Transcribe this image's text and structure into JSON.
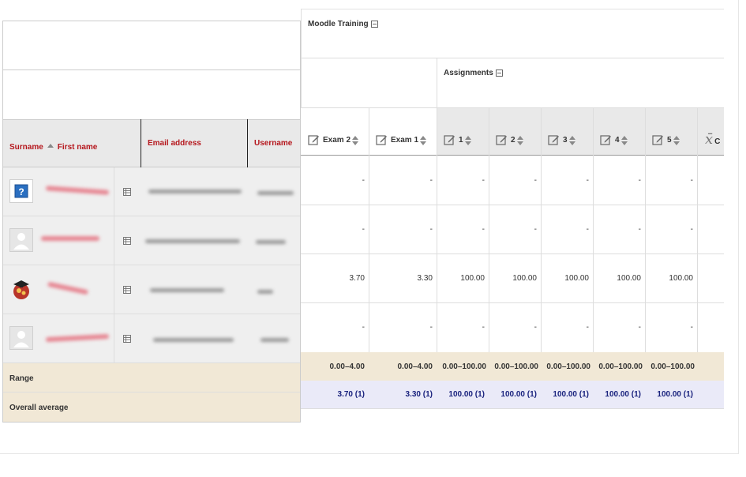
{
  "course": {
    "title": "Moodle Training"
  },
  "category": {
    "title": "Assignments"
  },
  "user_columns": {
    "surname": "Surname",
    "first_name": "First name",
    "email": "Email address",
    "username": "Username"
  },
  "grade_columns": [
    {
      "label": "Exam 2"
    },
    {
      "label": "Exam 1"
    },
    {
      "label": "1"
    },
    {
      "label": "2"
    },
    {
      "label": "3"
    },
    {
      "label": "4"
    },
    {
      "label": "5"
    },
    {
      "label": "C"
    }
  ],
  "rows": [
    {
      "avatar": "question-avatar",
      "grades": [
        "-",
        "-",
        "-",
        "-",
        "-",
        "-",
        "-"
      ]
    },
    {
      "avatar": "default-avatar",
      "grades": [
        "-",
        "-",
        "-",
        "-",
        "-",
        "-",
        "-"
      ]
    },
    {
      "avatar": "graduate-avatar",
      "grades": [
        "3.70",
        "3.30",
        "100.00",
        "100.00",
        "100.00",
        "100.00",
        "100.00"
      ]
    },
    {
      "avatar": "default-avatar",
      "grades": [
        "-",
        "-",
        "-",
        "-",
        "-",
        "-",
        "-"
      ]
    }
  ],
  "range": {
    "label": "Range",
    "values": [
      "0.00–4.00",
      "0.00–4.00",
      "0.00–100.00",
      "0.00–100.00",
      "0.00–100.00",
      "0.00–100.00",
      "0.00–100.00"
    ]
  },
  "overall_average": {
    "label": "Overall average",
    "values": [
      "3.70 (1)",
      "3.30 (1)",
      "100.00 (1)",
      "100.00 (1)",
      "100.00 (1)",
      "100.00 (1)",
      "100.00 (1)"
    ]
  },
  "colors": {
    "accent_red": "#b5161c",
    "header_grey": "#e9e9e9",
    "range_bg": "#f1e8d6",
    "average_bg": "#eaeaf8",
    "average_text": "#1a237e"
  }
}
